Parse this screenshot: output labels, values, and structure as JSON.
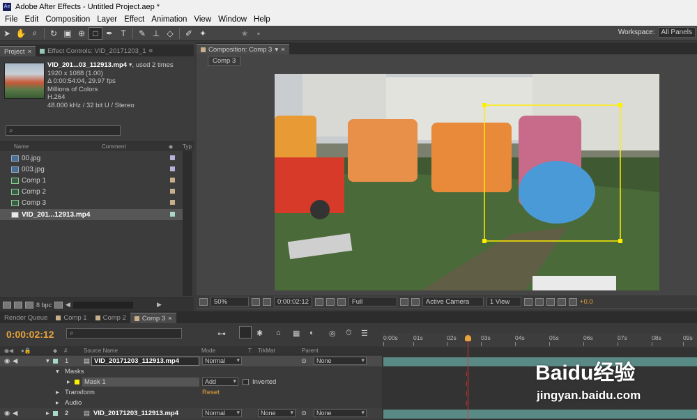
{
  "window": {
    "title": "Adobe After Effects - Untitled Project.aep *",
    "app_icon": "Ae"
  },
  "menu": [
    "File",
    "Edit",
    "Composition",
    "Layer",
    "Effect",
    "Animation",
    "View",
    "Window",
    "Help"
  ],
  "workspace": {
    "label": "Workspace:",
    "value": "All Panels"
  },
  "project": {
    "tab_project": "Project",
    "tab_effects": "Effect Controls: VID_20171203_1",
    "file": {
      "name": "VID_201...03_112913.mp4",
      "used": ", used 2 times",
      "lines": [
        "1920 x 1088 (1.00)",
        "Δ 0:00:54:04, 29.97 fps",
        "Millions of Colors",
        "H.264",
        "48.000 kHz / 32 bit U / Stereo"
      ]
    },
    "columns": {
      "name": "Name",
      "comment": "Comment",
      "type": "Typ"
    },
    "items": [
      {
        "name": "00.jpg",
        "kind": "image",
        "color": "#b8b0d8"
      },
      {
        "name": "003.jpg",
        "kind": "image",
        "color": "#b8b0d8"
      },
      {
        "name": "Comp 1",
        "kind": "comp",
        "color": "#c9b08a"
      },
      {
        "name": "Comp 2",
        "kind": "comp",
        "color": "#c9b08a"
      },
      {
        "name": "Comp 3",
        "kind": "comp",
        "color": "#c9b08a"
      },
      {
        "name": "VID_201...12913.mp4",
        "kind": "video",
        "color": "#a8d8c8",
        "selected": true
      }
    ],
    "bpc": "8 bpc"
  },
  "composition": {
    "tab": "Composition: Comp 3",
    "sub_tab": "Comp 3",
    "zoom": "50%",
    "timecode": "0:00:02:12",
    "resolution": "Full",
    "camera": "Active Camera",
    "views": "1 View",
    "exposure": "+0.0"
  },
  "timeline": {
    "tabs": [
      {
        "label": "Render Queue",
        "color": ""
      },
      {
        "label": "Comp 1",
        "color": "#c9b08a"
      },
      {
        "label": "Comp 2",
        "color": "#c9b08a"
      },
      {
        "label": "Comp 3",
        "color": "#c9b08a"
      }
    ],
    "timecode": "0:00:02:12",
    "columns": {
      "num": "#",
      "source": "Source Name",
      "mode": "Mode",
      "t": "T",
      "trkmat": "TrkMat",
      "parent": "Parent"
    },
    "layer1": {
      "num": "1",
      "name": "VID_20171203_112913.mp4",
      "mode": "Normal",
      "parent": "None"
    },
    "masks": "Masks",
    "mask1": {
      "name": "Mask 1",
      "mode": "Add",
      "inverted": "Inverted"
    },
    "transform": {
      "label": "Transform",
      "reset": "Reset"
    },
    "audio": "Audio",
    "layer2": {
      "num": "2",
      "name": "VID_20171203_112913.mp4",
      "mode": "Normal",
      "trkmat": "None",
      "parent": "None"
    },
    "ruler": [
      "0:00s",
      "01s",
      "02s",
      "03s",
      "04s",
      "05s",
      "06s",
      "07s",
      "08s",
      "09s"
    ],
    "playhead_time": 2.4
  },
  "watermark": {
    "brand": "Baidu经验",
    "url": "jingyan.baidu.com"
  },
  "colors": {
    "accent": "#e8a33a",
    "playhead": "#e03030",
    "mask": "#ffee00"
  }
}
